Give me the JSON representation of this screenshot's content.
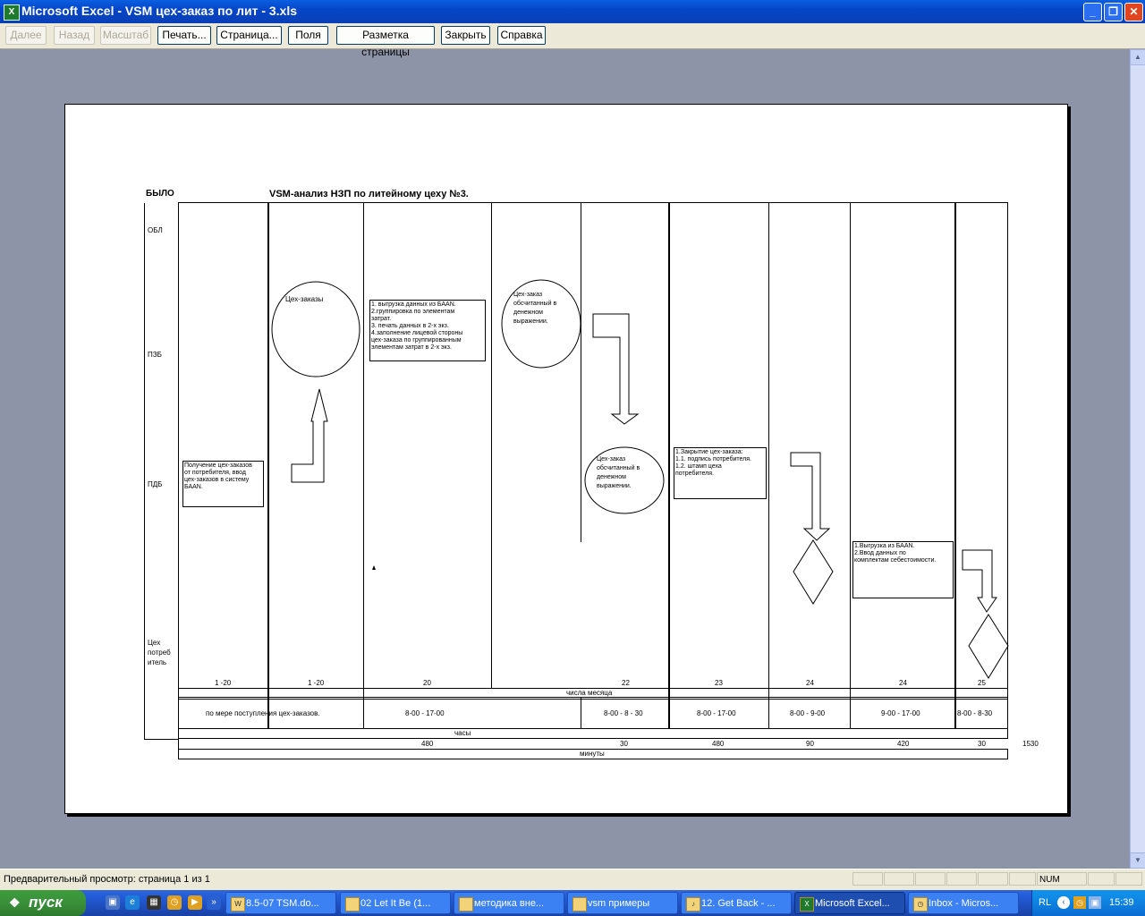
{
  "window": {
    "title": "Microsoft Excel - VSM  цех-заказ по лит - 3.xls",
    "app_icon": "X",
    "minimize": "_",
    "maximize": "❐",
    "close": "✕"
  },
  "toolbar": {
    "next": "Далее",
    "prev": "Назад",
    "zoom": "Масштаб",
    "print": "Печать...",
    "setup": "Страница...",
    "margins": "Поля",
    "page_break": "Разметка страницы",
    "close": "Закрыть",
    "help": "Справка"
  },
  "sheet": {
    "top_left": "БЫЛО",
    "heading": "VSM-анализ  НЗП  по литейному цеху №3.",
    "rows": [
      "ОБЛ",
      "ПЗБ",
      "ПДБ",
      "Цех\nпотреб\nитель"
    ],
    "notes": {
      "a": "Получение цех-заказов\nот потребителя, ввод\nцех-заказов в систему\nБААN.",
      "b": "Цех-заказы",
      "c": "1. выгрузка данных из БААN.\n2.группировка по элементам\nзатрат.\n3. печать данных в 2-х экз.\n4.заполнение лицевой стороны\nцех-заказа по группированным\nэлементам затрат в 2-х экз.",
      "d": "Цех-заказ\nобсчитанный в\nденежном\nвыражении.",
      "e": "Цех-заказ\nобсчитанный в\nденежном\nвыражении.",
      "f": "1.Закрытие цех-заказа:\n1.1. подпись потребителя.\n1.2. штамп цеха\nпотребителя.",
      "g": "1.Выгрузка из БААN.\n2.Ввод данных по\nкомплектам себестоимости."
    },
    "days": [
      "1 -20",
      "1 -20",
      "20",
      "22",
      "23",
      "24",
      "24",
      "25"
    ],
    "days_label": "числа месяца",
    "hours": [
      "по мере поступления цех-заказов.",
      "8-00 - 17-00",
      "8-00 - 8 - 30",
      "8-00 - 17-00",
      "8-00 - 9-00",
      "9-00 - 17-00",
      "8-00   -   8-30"
    ],
    "hours_label": "часы",
    "minutes": [
      "480",
      "30",
      "480",
      "90",
      "420",
      "30"
    ],
    "minutes_total": "1530",
    "minutes_label": "минуты"
  },
  "status": {
    "text": "Предварительный просмотр: страница 1 из 1",
    "num": "NUM"
  },
  "taskbar": {
    "start": "пуск",
    "tasks": [
      "8.5-07 TSM.do...",
      "02 Let It Be (1...",
      "методика вне...",
      "vsm примеры",
      "12. Get Back - ...",
      "Microsoft Excel...",
      "Inbox - Micros..."
    ],
    "lang": "RL",
    "clock": "15:39"
  }
}
